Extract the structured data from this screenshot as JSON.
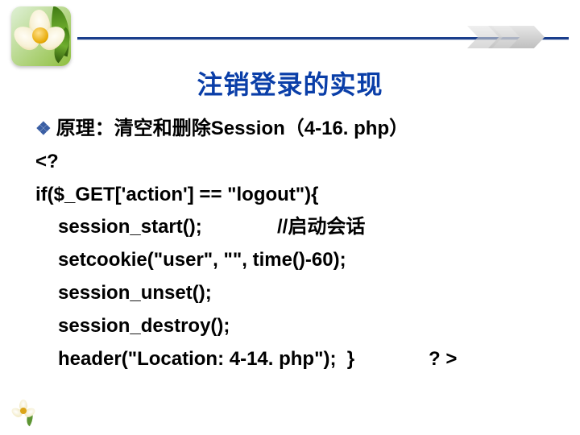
{
  "title": "注销登录的实现",
  "bullet": {
    "text": "原理：清空和删除Session（4-16. php）"
  },
  "code": {
    "l1": "<?",
    "l2": "if($_GET['action'] == \"logout\"){",
    "l3_left": "session_start();",
    "l3_right": "//启动会话",
    "l4": "setcookie(\"user\", \"\", time()-60);",
    "l5": "session_unset();",
    "l6": "session_destroy();",
    "l7_left": "header(\"Location: 4-14. php\");  }",
    "l7_right": "? >"
  }
}
